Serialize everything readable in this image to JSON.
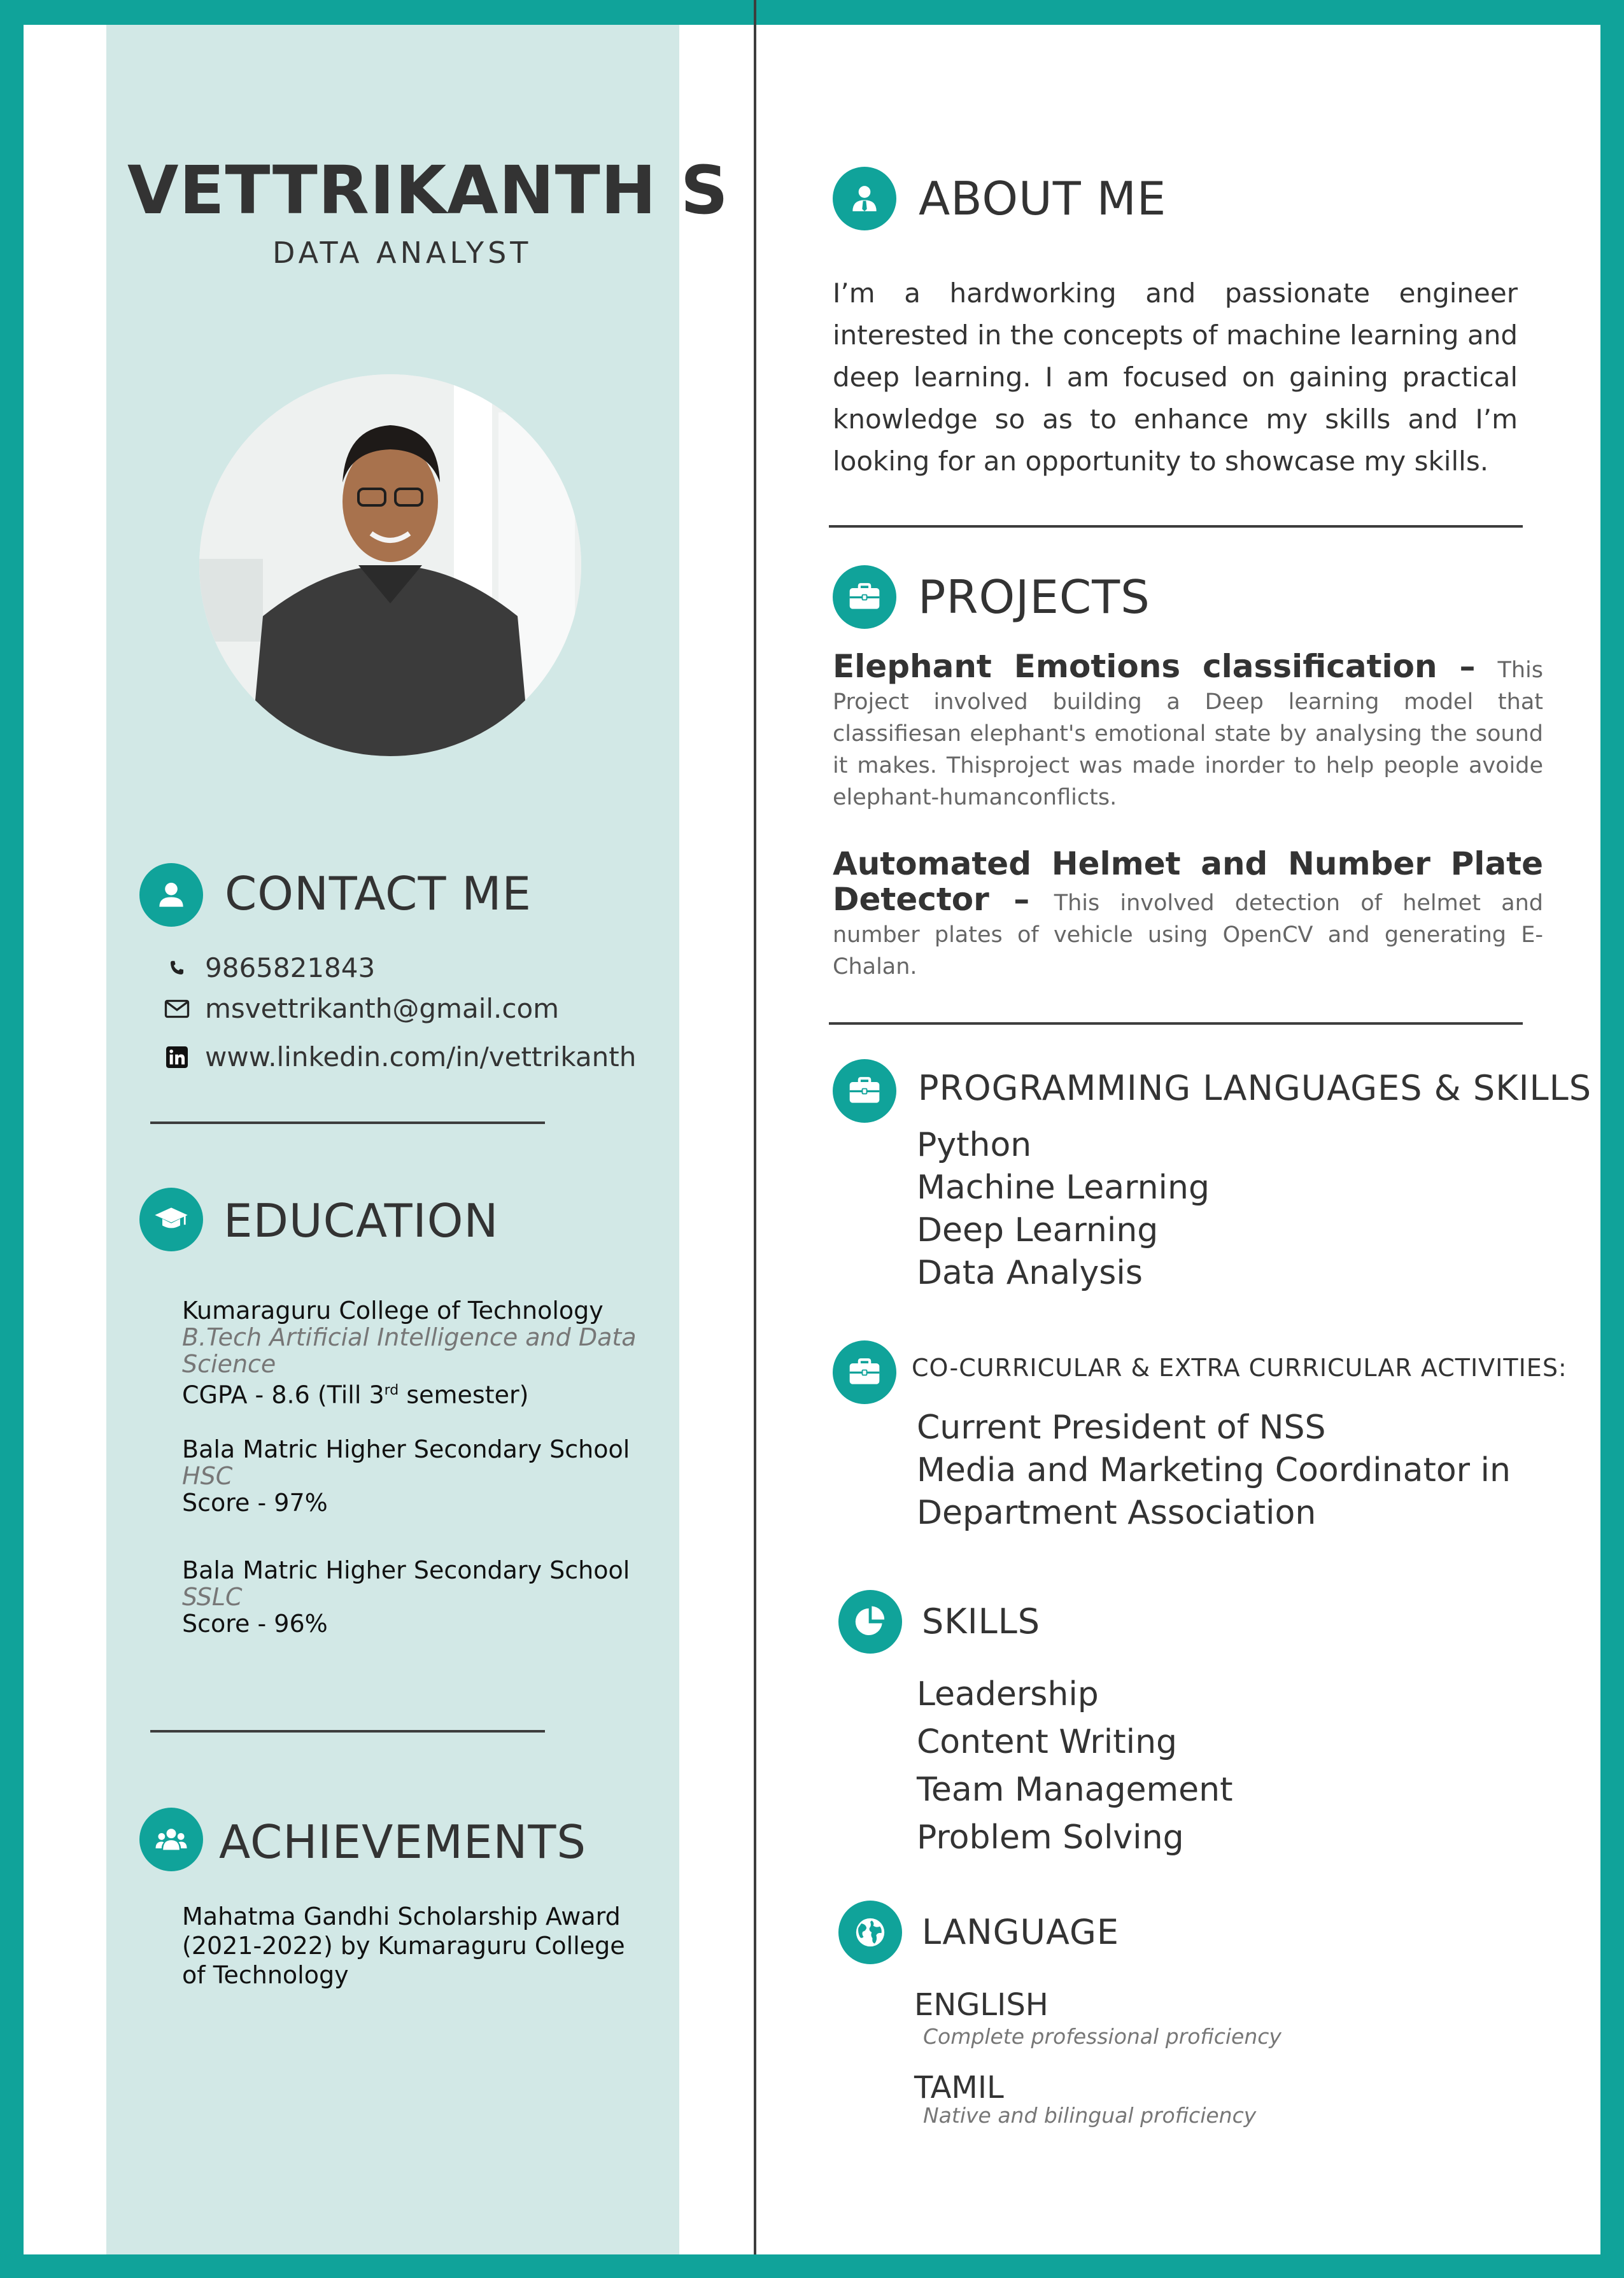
{
  "header": {
    "name": "VETTRIKANTH S",
    "role": "DATA ANALYST"
  },
  "contact": {
    "heading": "CONTACT ME",
    "phone": "9865821843",
    "email": "msvettrikanth@gmail.com",
    "linkedin": "www.linkedin.com/in/vettrikanth"
  },
  "education": {
    "heading": "EDUCATION",
    "entries": [
      {
        "school": "Kumaraguru College of Technology",
        "degree": "B.Tech Artificial Intelligence and Data Science",
        "score_prefix": "CGPA - 8.6 (Till 3",
        "score_sup": "rd",
        "score_suffix": " semester)"
      },
      {
        "school": "Bala Matric Higher Secondary School",
        "degree": "HSC",
        "score": "Score - 97%"
      },
      {
        "school": "Bala Matric Higher Secondary School",
        "degree": "SSLC",
        "score": "Score - 96%"
      }
    ]
  },
  "achievements": {
    "heading": "ACHIEVEMENTS",
    "text": "Mahatma Gandhi Scholarship Award (2021-2022) by Kumaraguru College of Technology"
  },
  "about": {
    "heading": "ABOUT ME",
    "text": "I’m a hardworking and passionate engineer interested in the concepts of machine learning and deep learning. I am focused on gaining practical knowledge so as to enhance my skills and I’m looking for an opportunity to showcase my skills."
  },
  "projects": {
    "heading": "PROJECTS",
    "items": [
      {
        "title": "Elephant Emotions classification",
        "sep": " – ",
        "desc": "This Project involved building a Deep learning model that classifiesan elephant's emotional state by analysing the sound it makes. Thisproject was made inorder to help people avoide elephant-humanconflicts."
      },
      {
        "title": "Automated Helmet and Number Plate Detector",
        "sep": " – ",
        "desc": "This involved detection of helmet and number plates of vehicle using OpenCV and generating E-Chalan."
      }
    ]
  },
  "programming": {
    "heading": "PROGRAMMING LANGUAGES & SKILLS",
    "items": [
      "Python",
      "Machine Learning",
      "Deep Learning",
      "Data Analysis"
    ]
  },
  "activities": {
    "heading": "CO-CURRICULAR & EXTRA CURRICULAR ACTIVITIES:",
    "items": [
      "Current President of NSS",
      "Media and Marketing Coordinator in",
      "Department Association"
    ]
  },
  "skills": {
    "heading": "SKILLS",
    "items": [
      "Leadership",
      "Content Writing",
      "Team Management",
      "Problem Solving"
    ]
  },
  "language": {
    "heading": "LANGUAGE",
    "items": [
      {
        "name": "ENGLISH",
        "level": "Complete professional proficiency"
      },
      {
        "name": "TAMIL",
        "level": "Native and bilingual proficiency"
      }
    ]
  },
  "colors": {
    "accent": "#10a39a",
    "sidebar": "#d2e8e6",
    "text": "#333333"
  },
  "icons": {
    "about": "user-tie-icon",
    "contact": "user-icon",
    "education": "graduation-cap-icon",
    "achievements": "users-icon",
    "projects": "briefcase-icon",
    "programming": "briefcase-icon",
    "activities": "briefcase-icon",
    "skills": "pie-chart-icon",
    "language": "globe-icon",
    "phone": "phone-icon",
    "email": "envelope-icon",
    "linkedin": "linkedin-icon"
  }
}
